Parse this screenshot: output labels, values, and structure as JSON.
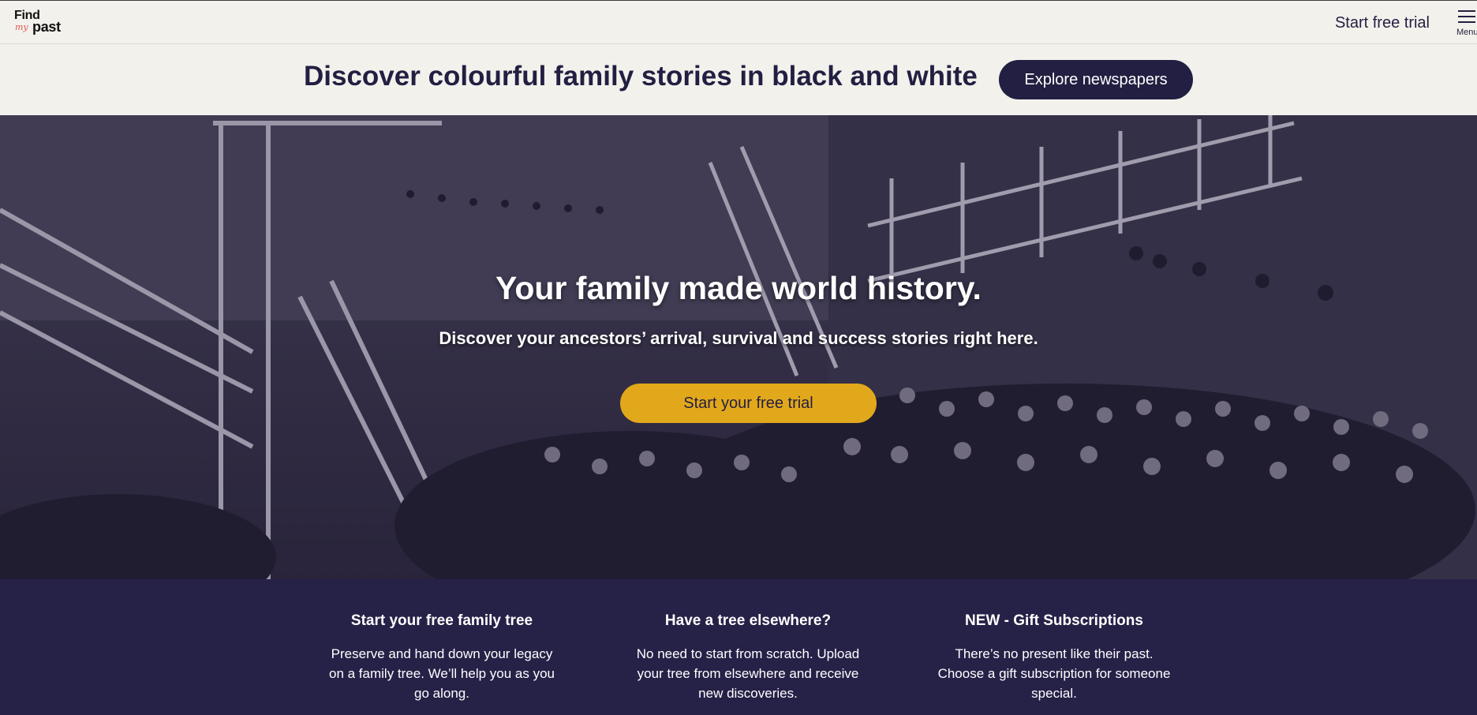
{
  "header": {
    "logo": {
      "find": "Find",
      "my": "my",
      "past": "past"
    },
    "start_trial_label": "Start free trial",
    "menu_label": "Menu"
  },
  "promo": {
    "text": "Discover colourful family stories in black and white",
    "button_label": "Explore newspapers"
  },
  "hero": {
    "title": "Your family made world history.",
    "subtitle": "Discover your ancestors’ arrival, survival and success stories right here.",
    "cta_label": "Start your free trial"
  },
  "features": [
    {
      "title": "Start your free family tree",
      "body": "Preserve and hand down your legacy on a family tree. We’ll help you as you go along."
    },
    {
      "title": "Have a tree elsewhere?",
      "body": "No need to start from scratch. Upload your tree from elsewhere and receive new discoveries."
    },
    {
      "title": "NEW - Gift Subscriptions",
      "body": "There’s no present like their past. Choose a gift subscription for someone special."
    }
  ],
  "colors": {
    "navy": "#231f42",
    "gold": "#e2a81b",
    "cream": "#f3f1ec",
    "footer_navy": "#262147"
  }
}
